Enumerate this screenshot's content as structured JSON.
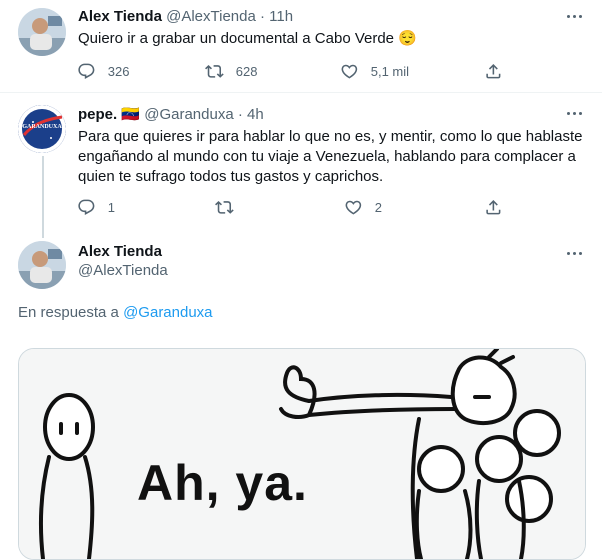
{
  "tweet1": {
    "name": "Alex Tienda",
    "handle": "@AlexTienda",
    "dot": "·",
    "time": "11h",
    "text": "Quiero ir a grabar un documental a Cabo Verde 😌",
    "replies": "326",
    "retweets": "628",
    "likes": "5,1 mil"
  },
  "tweet2": {
    "name": "pepe.",
    "flag": "🇻🇪",
    "handle": "@Garanduxa",
    "dot": "·",
    "time": "4h",
    "avatar_text": "GARANDUXA",
    "text_lines": [
      "Para que quieres ir para hablar lo que no es, y mentir, como lo que hablaste",
      "engañando al mundo con tu viaje a Venezuela, hablando para complacer a",
      "quien te sufrago todos tus gastos y caprichos."
    ],
    "replies": "1",
    "retweets": "",
    "likes": "2"
  },
  "tweet3": {
    "name": "Alex Tienda",
    "handle": "@AlexTienda",
    "reply_prefix": "En respuesta a",
    "reply_mention": "@Garanduxa",
    "media_caption": "Ah, ya."
  },
  "colors": {
    "text": "#0f1419",
    "secondary": "#536471",
    "link": "#1d9bf0",
    "border": "#cfd9de"
  },
  "icons": [
    "reply-icon",
    "retweet-icon",
    "like-icon",
    "share-icon",
    "more-icon"
  ]
}
